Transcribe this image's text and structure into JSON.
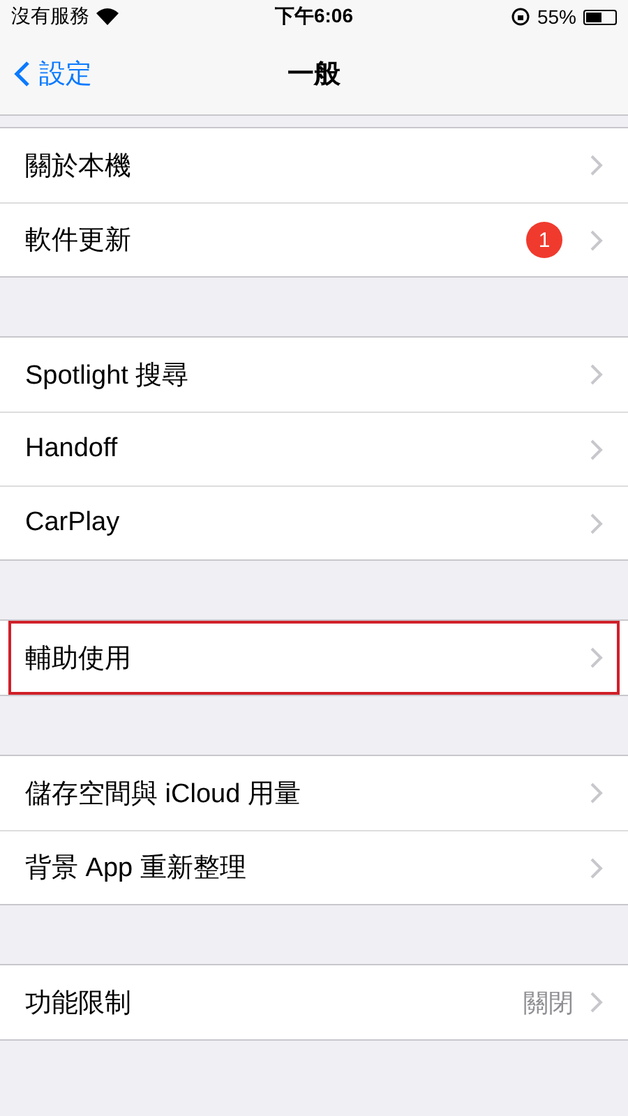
{
  "status_bar": {
    "carrier": "沒有服務",
    "time": "下午6:06",
    "battery": "55%"
  },
  "nav_bar": {
    "back": "設定",
    "title": "一般"
  },
  "groups": [
    {
      "items": [
        {
          "label": "關於本機",
          "highlighted": false
        },
        {
          "label": "軟件更新",
          "badge": "1",
          "highlighted": false
        }
      ]
    },
    {
      "items": [
        {
          "label": "Spotlight 搜尋",
          "highlighted": false
        },
        {
          "label": "Handoff",
          "highlighted": false
        },
        {
          "label": "CarPlay",
          "highlighted": false
        }
      ]
    },
    {
      "items": [
        {
          "label": "輔助使用",
          "highlighted": true
        }
      ]
    },
    {
      "items": [
        {
          "label": "儲存空間與 iCloud 用量",
          "highlighted": false
        },
        {
          "label": "背景 App 重新整理",
          "highlighted": false
        }
      ]
    },
    {
      "items": [
        {
          "label": "功能限制",
          "value": "關閉",
          "highlighted": false
        }
      ]
    }
  ]
}
